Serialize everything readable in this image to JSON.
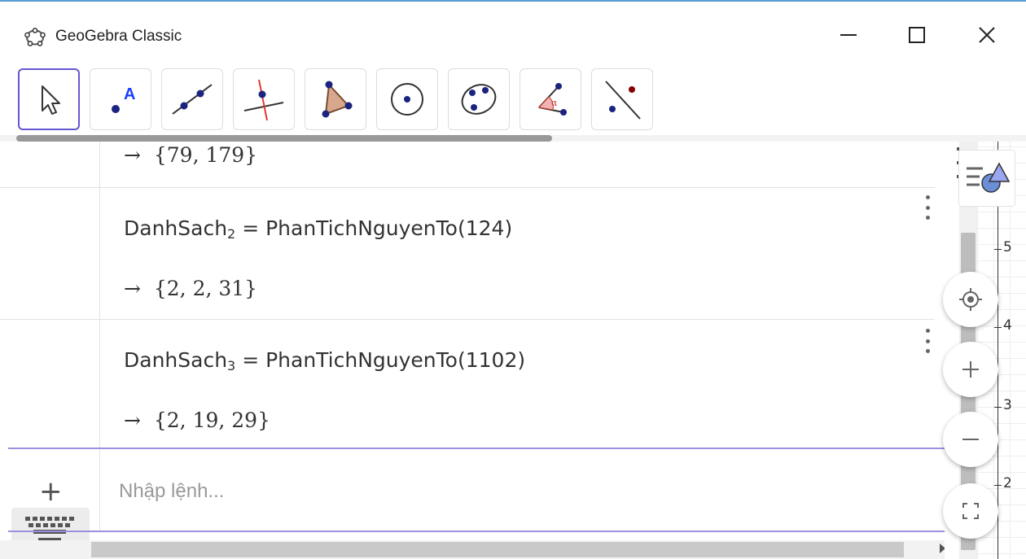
{
  "window": {
    "title": "GeoGebra Classic"
  },
  "toolbar": {
    "tools": [
      "move-tool",
      "point-tool",
      "line-tool",
      "perpendicular-line-tool",
      "polygon-tool",
      "circle-center-point-tool",
      "ellipse-tool",
      "angle-tool",
      "reflect-about-line-tool"
    ],
    "active_tool": "move-tool"
  },
  "algebra": {
    "partial_result": "{79, 179}",
    "items": [
      {
        "name": "DanhSach",
        "subscript": "2",
        "equals": "=",
        "command": "PhanTichNguyenTo",
        "argument": "(124)",
        "result": "{2, 2, 31}"
      },
      {
        "name": "DanhSach",
        "subscript": "3",
        "equals": "=",
        "command": "PhanTichNguyenTo",
        "argument": "(1102)",
        "result": "{2, 19, 29}"
      }
    ],
    "arrow": "→",
    "input_placeholder": "Nhập lệnh...",
    "add_symbol": "+"
  },
  "graphics": {
    "y_labels": [
      "5",
      "4",
      "3",
      "2"
    ]
  },
  "colors": {
    "active_tool_border": "#6557d2",
    "input_line": "#9b8fe0",
    "accent_top": "#5b9bd5"
  }
}
